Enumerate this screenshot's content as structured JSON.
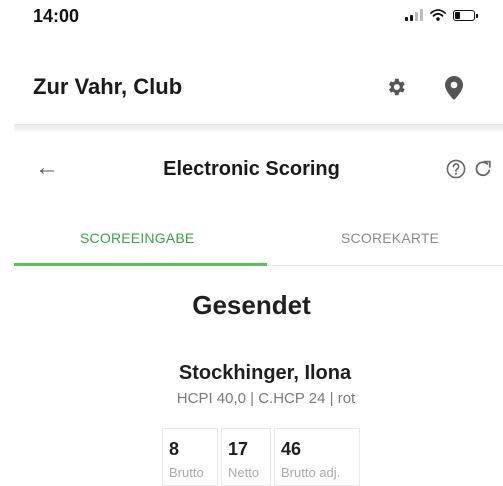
{
  "status_bar": {
    "time": "14:00"
  },
  "app_bar": {
    "title": "Zur Vahr, Club"
  },
  "nav": {
    "title": "Electronic Scoring"
  },
  "tabs": [
    {
      "label": "SCOREEINGABE",
      "active": true
    },
    {
      "label": "SCOREKARTE",
      "active": false
    }
  ],
  "status_heading": "Gesendet",
  "player": {
    "name": "Stockhinger, Ilona",
    "info": "HCPI 40,0 | C.HCP 24 | rot"
  },
  "scores": [
    {
      "value": "8",
      "label": "Brutto"
    },
    {
      "value": "17",
      "label": "Netto"
    },
    {
      "value": "46",
      "label": "Brutto adj."
    }
  ],
  "colors": {
    "accent": "#5cbf51",
    "active_tab_text": "#3aa53f"
  },
  "icons": [
    "signal-icon",
    "wifi-icon",
    "battery-icon",
    "gear-icon",
    "location-pin-icon",
    "back-arrow-icon",
    "help-icon",
    "refresh-icon"
  ]
}
